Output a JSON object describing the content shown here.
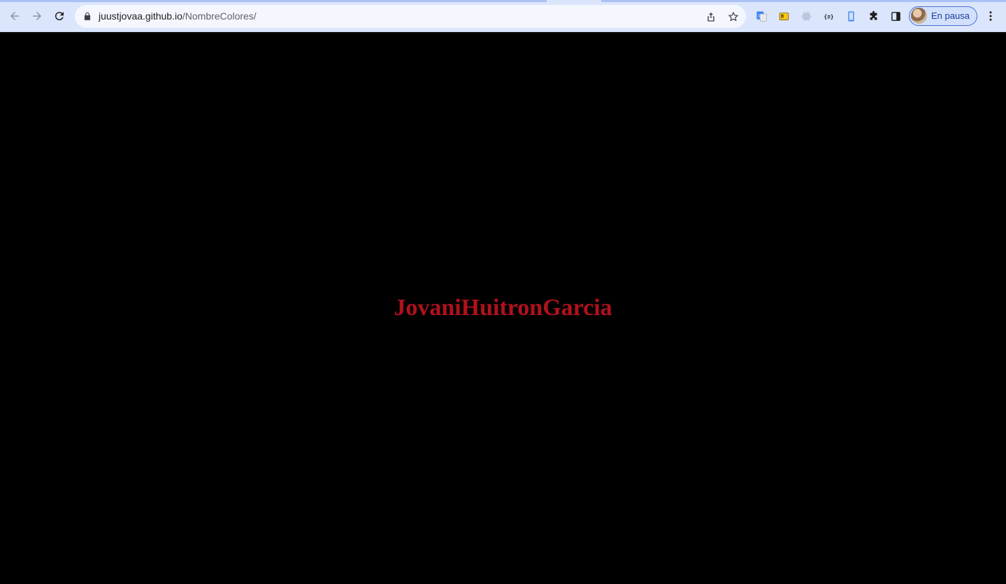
{
  "browser": {
    "url_host": "juustjovaa.github.io",
    "url_path": "/NombreColores/",
    "profile_label": "En pausa",
    "accent_color": "#4a6fd8"
  },
  "page": {
    "name_text": "JovaniHuitronGarcia",
    "name_color": "#b0111c",
    "background_color": "#000000"
  },
  "icons": {
    "back": "arrow-left-icon",
    "forward": "arrow-right-icon",
    "reload": "reload-icon",
    "lock": "lock-icon",
    "share": "share-icon",
    "bookmark": "star-icon",
    "extensions": [
      "google-translate-icon",
      "folder-extension-icon",
      "react-devtools-icon",
      "json-viewer-icon",
      "device-extension-icon",
      "puzzle-icon",
      "side-panel-icon"
    ],
    "menu": "kebab-menu-icon"
  }
}
